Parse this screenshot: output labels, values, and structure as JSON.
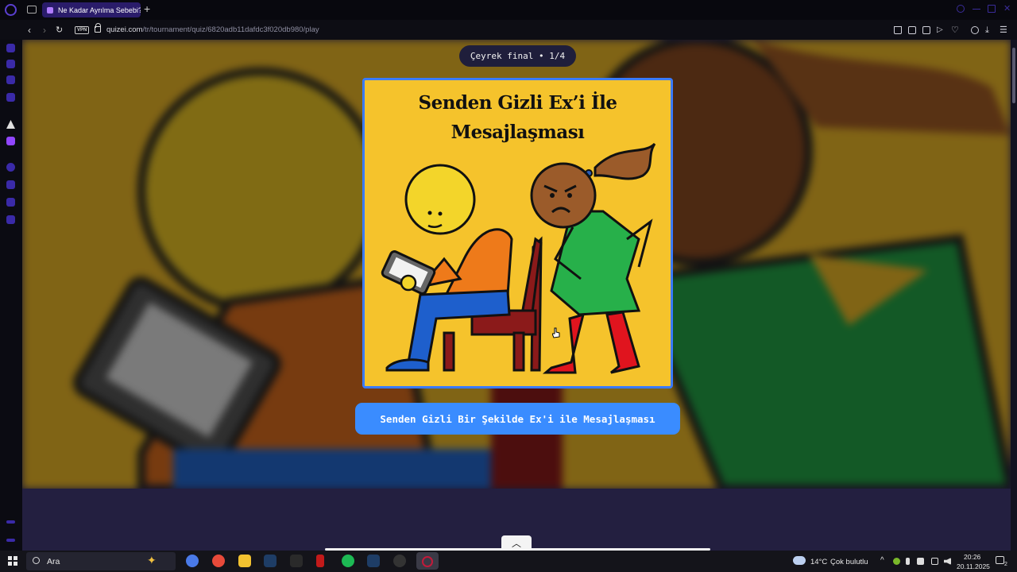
{
  "browser": {
    "tab_title": "Ne Kadar Ayrılma Sebebi?",
    "new_tab": "+",
    "url_host": "quizei.com",
    "url_path": "/tr/tournament/quiz/6820adb11dafdc3f020db980/play",
    "vpn_label": "VPN"
  },
  "quiz": {
    "round_label": "Çeyrek final • 1/4",
    "card_title_line1": "Senden Gizli Ex’i İle",
    "card_title_line2": "Mesajlaşması",
    "choice_label": "Senden Gizli Bir Şekilde Ex'i ile Mesajlaşması",
    "background_color": "#f5c32c",
    "accent": "#3a8cff"
  },
  "taskbar": {
    "search_placeholder": "Ara",
    "weather_temp": "14°C",
    "weather_desc": "Çok bulutlu",
    "time": "20:26",
    "date": "20.11.2025",
    "notification_count": "2"
  }
}
